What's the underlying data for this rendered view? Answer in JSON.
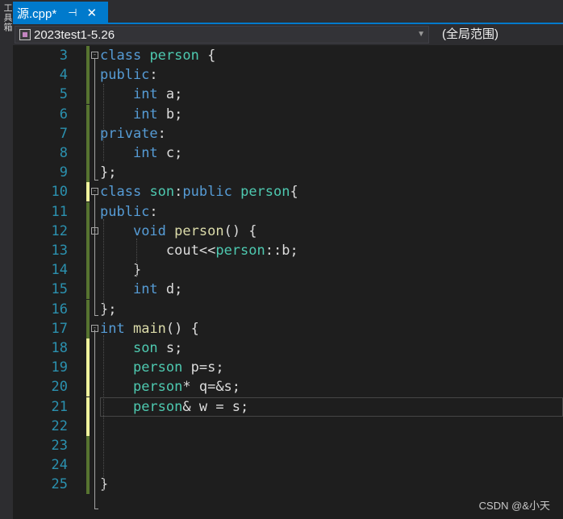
{
  "sidebar": {
    "vertical_text": "工具箱"
  },
  "tab": {
    "title": "源.cpp*",
    "pin_icon": "⊣",
    "close_icon": "✕"
  },
  "navbar": {
    "project": "2023test1-5.26",
    "scope": "(全局范围)"
  },
  "editor": {
    "lines": [
      {
        "num": "3",
        "change": "saved",
        "tokens": [
          [
            "kw",
            "class"
          ],
          [
            "t",
            " "
          ],
          [
            "ty",
            "person"
          ],
          [
            "t",
            " {"
          ]
        ]
      },
      {
        "num": "4",
        "change": "saved",
        "tokens": [
          [
            "kw",
            "public"
          ],
          [
            "t",
            ":"
          ]
        ]
      },
      {
        "num": "5",
        "change": "saved",
        "tokens": [
          [
            "t",
            "    "
          ],
          [
            "kw",
            "int"
          ],
          [
            "t",
            " a;"
          ]
        ]
      },
      {
        "num": "6",
        "change": "saved",
        "tokens": [
          [
            "t",
            "    "
          ],
          [
            "kw",
            "int"
          ],
          [
            "t",
            " b;"
          ]
        ]
      },
      {
        "num": "7",
        "change": "saved",
        "tokens": [
          [
            "kw",
            "private"
          ],
          [
            "t",
            ":"
          ]
        ]
      },
      {
        "num": "8",
        "change": "saved",
        "tokens": [
          [
            "t",
            "    "
          ],
          [
            "kw",
            "int"
          ],
          [
            "t",
            " c;"
          ]
        ]
      },
      {
        "num": "9",
        "change": "saved",
        "tokens": [
          [
            "t",
            "};"
          ]
        ]
      },
      {
        "num": "10",
        "change": "unsaved",
        "tokens": [
          [
            "kw",
            "class"
          ],
          [
            "t",
            " "
          ],
          [
            "ty",
            "son"
          ],
          [
            "t",
            ":"
          ],
          [
            "kw",
            "public"
          ],
          [
            "t",
            " "
          ],
          [
            "ty",
            "person"
          ],
          [
            "t",
            "{"
          ]
        ]
      },
      {
        "num": "11",
        "change": "saved",
        "tokens": [
          [
            "kw",
            "public"
          ],
          [
            "t",
            ":"
          ]
        ]
      },
      {
        "num": "12",
        "change": "saved",
        "tokens": [
          [
            "t",
            "    "
          ],
          [
            "kw",
            "void"
          ],
          [
            "t",
            " "
          ],
          [
            "fn",
            "person"
          ],
          [
            "t",
            "() {"
          ]
        ]
      },
      {
        "num": "13",
        "change": "saved",
        "tokens": [
          [
            "t",
            "        "
          ],
          [
            "t",
            "cout"
          ],
          [
            "t",
            "<<"
          ],
          [
            "ty",
            "person"
          ],
          [
            "t",
            "::b;"
          ]
        ]
      },
      {
        "num": "14",
        "change": "saved",
        "tokens": [
          [
            "t",
            "    }"
          ]
        ]
      },
      {
        "num": "15",
        "change": "saved",
        "tokens": [
          [
            "t",
            "    "
          ],
          [
            "kw",
            "int"
          ],
          [
            "t",
            " d;"
          ]
        ]
      },
      {
        "num": "16",
        "change": "saved",
        "tokens": [
          [
            "t",
            "};"
          ]
        ]
      },
      {
        "num": "17",
        "change": "saved",
        "tokens": [
          [
            "kw",
            "int"
          ],
          [
            "t",
            " "
          ],
          [
            "fn",
            "main"
          ],
          [
            "t",
            "() {"
          ]
        ]
      },
      {
        "num": "18",
        "change": "unsaved",
        "tokens": [
          [
            "t",
            "    "
          ],
          [
            "ty",
            "son"
          ],
          [
            "t",
            " s;"
          ]
        ]
      },
      {
        "num": "19",
        "change": "unsaved",
        "tokens": [
          [
            "t",
            "    "
          ],
          [
            "ty",
            "person"
          ],
          [
            "t",
            " p=s;"
          ]
        ]
      },
      {
        "num": "20",
        "change": "unsaved",
        "tokens": [
          [
            "t",
            "    "
          ],
          [
            "ty",
            "person"
          ],
          [
            "t",
            "* q=&s;"
          ]
        ]
      },
      {
        "num": "21",
        "change": "unsaved",
        "tokens": [
          [
            "t",
            "    "
          ],
          [
            "ty",
            "person"
          ],
          [
            "t",
            "& w = s;"
          ]
        ]
      },
      {
        "num": "22",
        "change": "unsaved",
        "tokens": []
      },
      {
        "num": "23",
        "change": "saved",
        "tokens": []
      },
      {
        "num": "24",
        "change": "saved",
        "tokens": []
      },
      {
        "num": "25",
        "change": "saved",
        "tokens": [
          [
            "t",
            "}"
          ]
        ]
      }
    ]
  },
  "watermark": "CSDN @&小天",
  "colors": {
    "keyword": "#569cd6",
    "type": "#4ec9b0",
    "function": "#dcdcaa",
    "line_number": "#2b91af",
    "tab_active": "#007acc",
    "change_saved": "#577430",
    "change_unsaved": "#eff29c"
  }
}
